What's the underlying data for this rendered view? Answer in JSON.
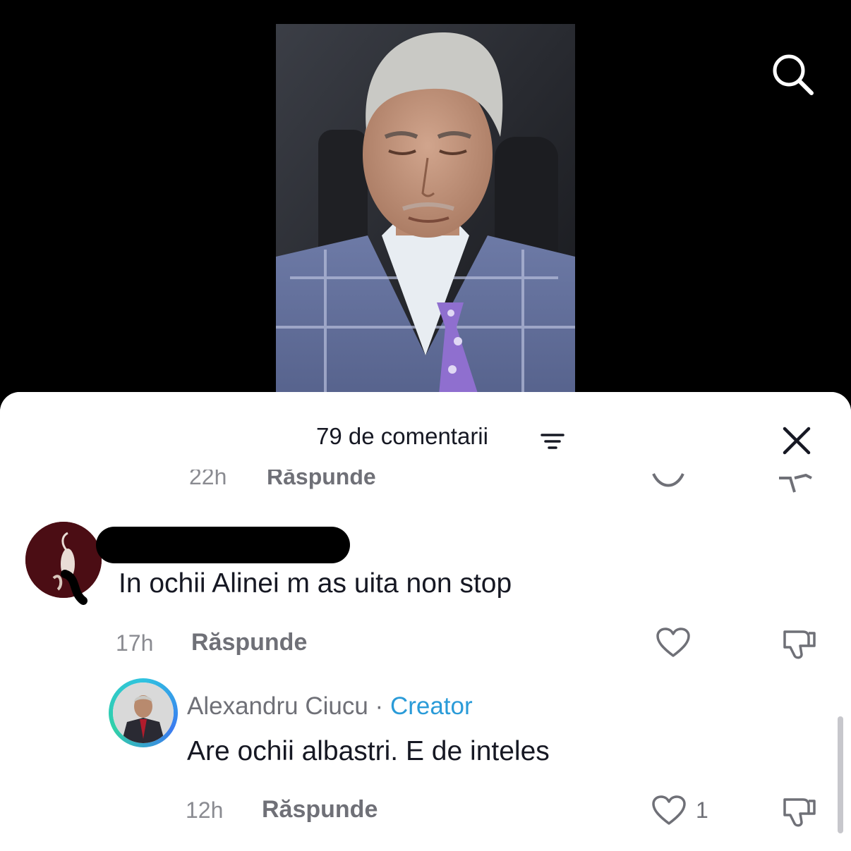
{
  "sheet": {
    "title": "79 de comentarii"
  },
  "previous_comment": {
    "time": "22h",
    "reply_label": "Răspunde"
  },
  "comment": {
    "text": "In ochii Alinei m as uita non stop",
    "time": "17h",
    "reply_label": "Răspunde"
  },
  "reply": {
    "author": "Alexandru Ciucu",
    "separator": "·",
    "badge": "Creator",
    "text": "Are ochii albastri. E de inteles",
    "time": "12h",
    "reply_label": "Răspunde",
    "like_count": "1"
  },
  "icons": {
    "search": "search-icon",
    "sort": "sort-icon",
    "close": "close-icon",
    "like": "heart-icon",
    "dislike": "thumbs-down-icon"
  },
  "colors": {
    "creator_badge": "#2a9bd8",
    "text_primary": "#161823",
    "text_secondary": "#6f7077"
  }
}
